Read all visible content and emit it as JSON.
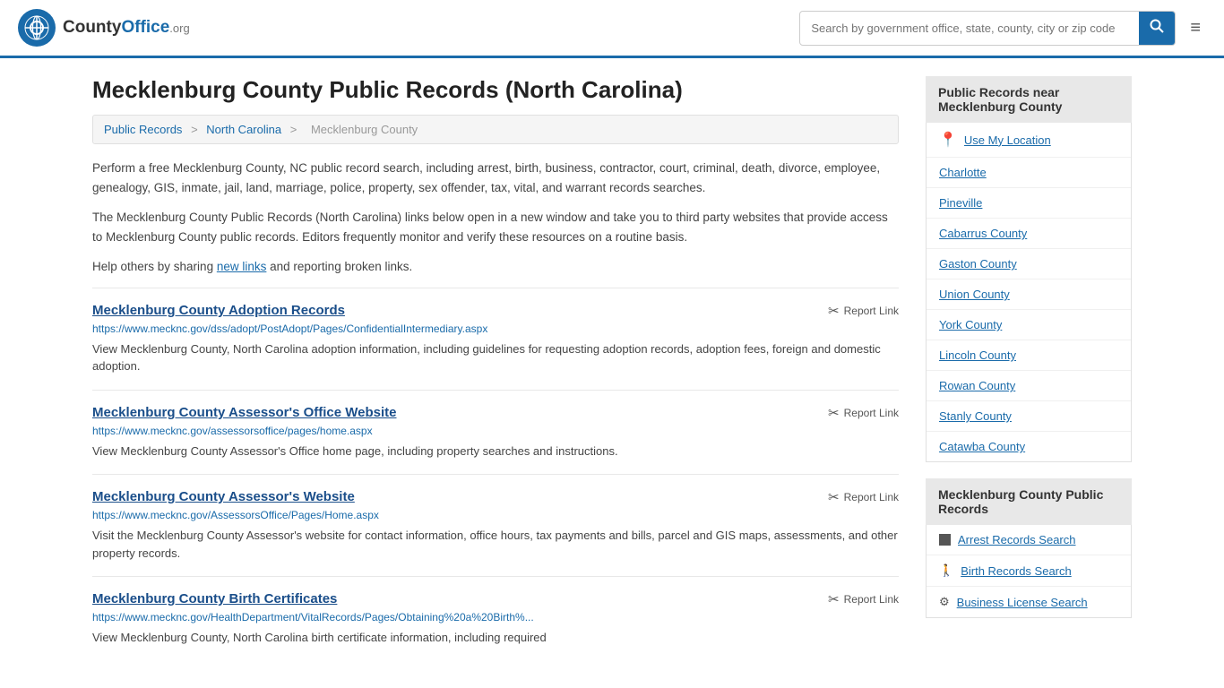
{
  "header": {
    "logo_text": "CountyOffice",
    "logo_org": ".org",
    "search_placeholder": "Search by government office, state, county, city or zip code",
    "menu_icon": "≡"
  },
  "page": {
    "title": "Mecklenburg County Public Records (North Carolina)",
    "breadcrumb": {
      "items": [
        "Public Records",
        "North Carolina",
        "Mecklenburg County"
      ]
    },
    "description1": "Perform a free Mecklenburg County, NC public record search, including arrest, birth, business, contractor, court, criminal, death, divorce, employee, genealogy, GIS, inmate, jail, land, marriage, police, property, sex offender, tax, vital, and warrant records searches.",
    "description2": "The Mecklenburg County Public Records (North Carolina) links below open in a new window and take you to third party websites that provide access to Mecklenburg County public records. Editors frequently monitor and verify these resources on a routine basis.",
    "description3": "Help others by sharing",
    "new_links_text": "new links",
    "description3b": "and reporting broken links."
  },
  "records": [
    {
      "title": "Mecklenburg County Adoption Records",
      "url": "https://www.mecknc.gov/dss/adopt/PostAdopt/Pages/ConfidentialIntermediary.aspx",
      "description": "View Mecklenburg County, North Carolina adoption information, including guidelines for requesting adoption records, adoption fees, foreign and domestic adoption.",
      "report_label": "Report Link"
    },
    {
      "title": "Mecklenburg County Assessor's Office Website",
      "url": "https://www.mecknc.gov/assessorsoffice/pages/home.aspx",
      "description": "View Mecklenburg County Assessor's Office home page, including property searches and instructions.",
      "report_label": "Report Link"
    },
    {
      "title": "Mecklenburg County Assessor's Website",
      "url": "https://www.mecknc.gov/AssessorsOffice/Pages/Home.aspx",
      "description": "Visit the Mecklenburg County Assessor's website for contact information, office hours, tax payments and bills, parcel and GIS maps, assessments, and other property records.",
      "report_label": "Report Link"
    },
    {
      "title": "Mecklenburg County Birth Certificates",
      "url": "https://www.mecknc.gov/HealthDepartment/VitalRecords/Pages/Obtaining%20a%20Birth%...",
      "description": "View Mecklenburg County, North Carolina birth certificate information, including required",
      "report_label": "Report Link"
    }
  ],
  "sidebar": {
    "nearby_title": "Public Records near Mecklenburg County",
    "nearby_items": [
      {
        "label": "Use My Location",
        "icon": "location"
      },
      {
        "label": "Charlotte",
        "icon": "none"
      },
      {
        "label": "Pineville",
        "icon": "none"
      },
      {
        "label": "Cabarrus County",
        "icon": "none"
      },
      {
        "label": "Gaston County",
        "icon": "none"
      },
      {
        "label": "Union County",
        "icon": "none"
      },
      {
        "label": "York County",
        "icon": "none"
      },
      {
        "label": "Lincoln County",
        "icon": "none"
      },
      {
        "label": "Rowan County",
        "icon": "none"
      },
      {
        "label": "Stanly County",
        "icon": "none"
      },
      {
        "label": "Catawba County",
        "icon": "none"
      }
    ],
    "records_title": "Mecklenburg County Public Records",
    "records_items": [
      {
        "label": "Arrest Records Search",
        "icon": "square"
      },
      {
        "label": "Birth Records Search",
        "icon": "person"
      },
      {
        "label": "Business License Search",
        "icon": "gear"
      }
    ]
  }
}
